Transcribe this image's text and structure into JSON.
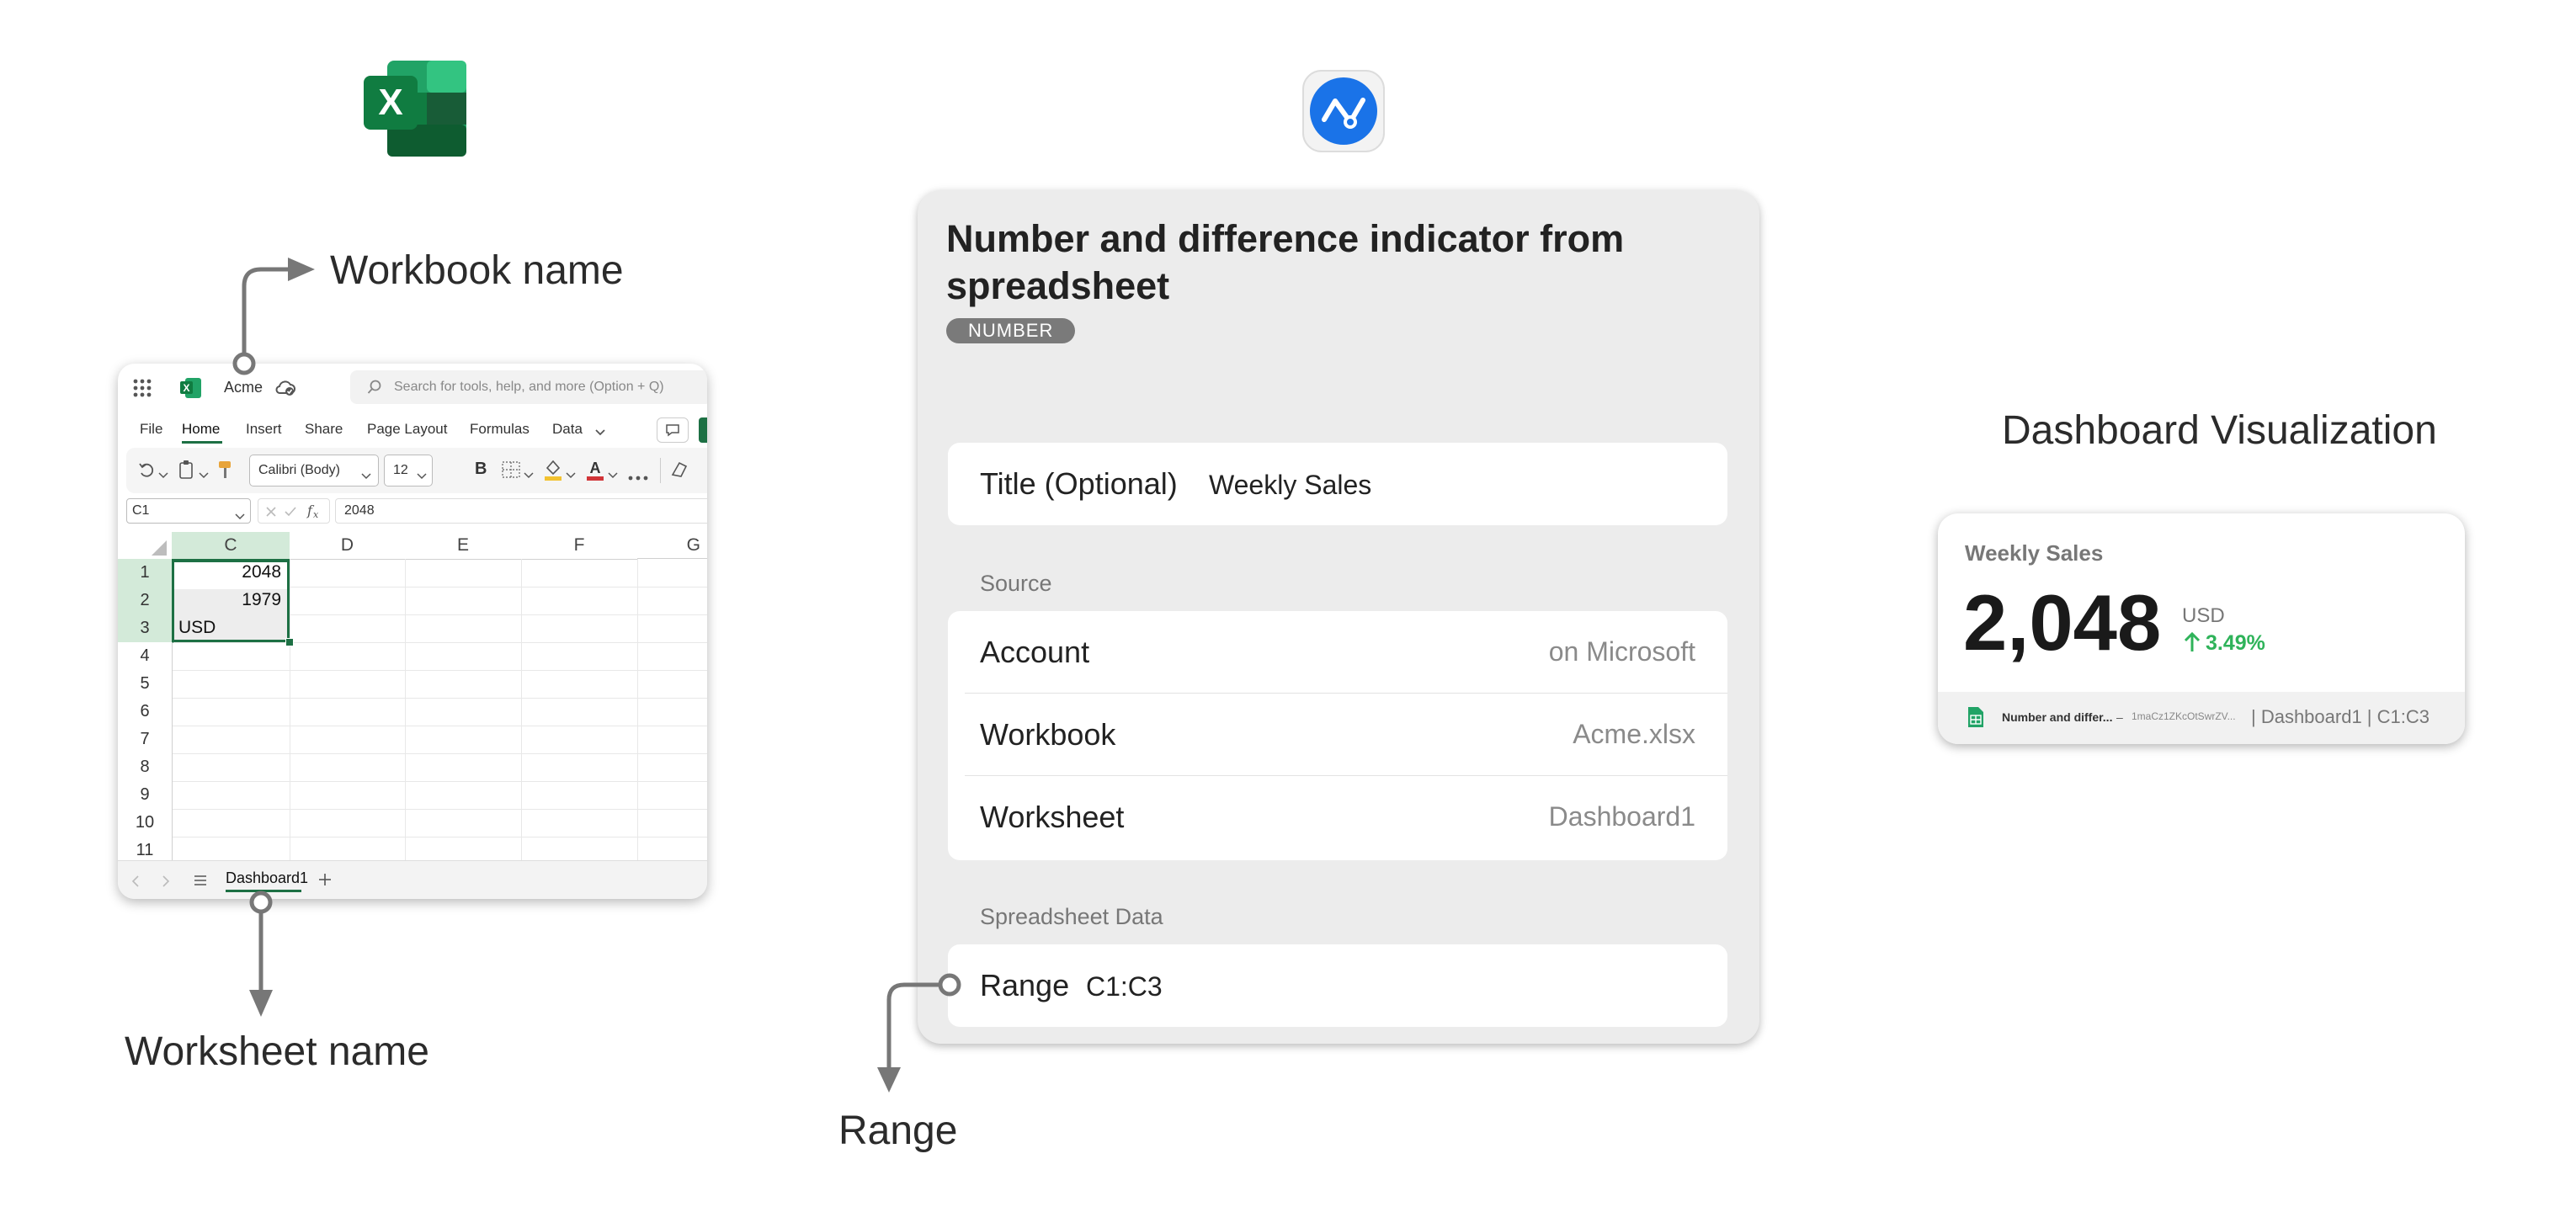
{
  "callouts": {
    "workbook_name": "Workbook name",
    "worksheet_name": "Worksheet name",
    "range": "Range",
    "dashboard_visualization": "Dashboard Visualization"
  },
  "excel": {
    "workbook": "Acme",
    "search_placeholder": "Search for tools, help, and more (Option + Q)",
    "menu": [
      "File",
      "Home",
      "Insert",
      "Share",
      "Page Layout",
      "Formulas",
      "Data"
    ],
    "active_menu": "Home",
    "font_name": "Calibri (Body)",
    "font_size": "12",
    "cell_ref": "C1",
    "formula_value": "2048",
    "columns": [
      "C",
      "D",
      "E",
      "F",
      "G"
    ],
    "rows": [
      "1",
      "2",
      "3",
      "4",
      "5",
      "6",
      "7",
      "8",
      "9",
      "10",
      "11"
    ],
    "cells": {
      "c1": "2048",
      "c2": "1979",
      "c3": "USD"
    },
    "sheet_tab": "Dashboard1",
    "bold_label": "B"
  },
  "panel": {
    "title": "Number and difference indicator from spreadsheet",
    "badge": "NUMBER",
    "title_row": {
      "label": "Title (Optional)",
      "value": "Weekly Sales"
    },
    "source_label": "Source",
    "source_rows": [
      {
        "label": "Account",
        "value": "on Microsoft"
      },
      {
        "label": "Workbook",
        "value": "Acme.xlsx"
      },
      {
        "label": "Worksheet",
        "value": "Dashboard1"
      }
    ],
    "spreadsheet_label": "Spreadsheet Data",
    "range_row": {
      "label": "Range",
      "value": "C1:C3"
    }
  },
  "widget": {
    "title": "Weekly Sales",
    "value": "2,048",
    "unit": "USD",
    "change": "3.49%",
    "footer_name": "Number and differ...",
    "footer_dash": "–",
    "footer_id": "1maCz1ZKcOtSwrZV...",
    "footer_path": "| Dashboard1 | C1:C3"
  },
  "colors": {
    "excel_green": "#1d7044",
    "app_blue": "#1a73e8",
    "positive": "#2fb35a",
    "badge_gray": "#7a7a7a"
  }
}
